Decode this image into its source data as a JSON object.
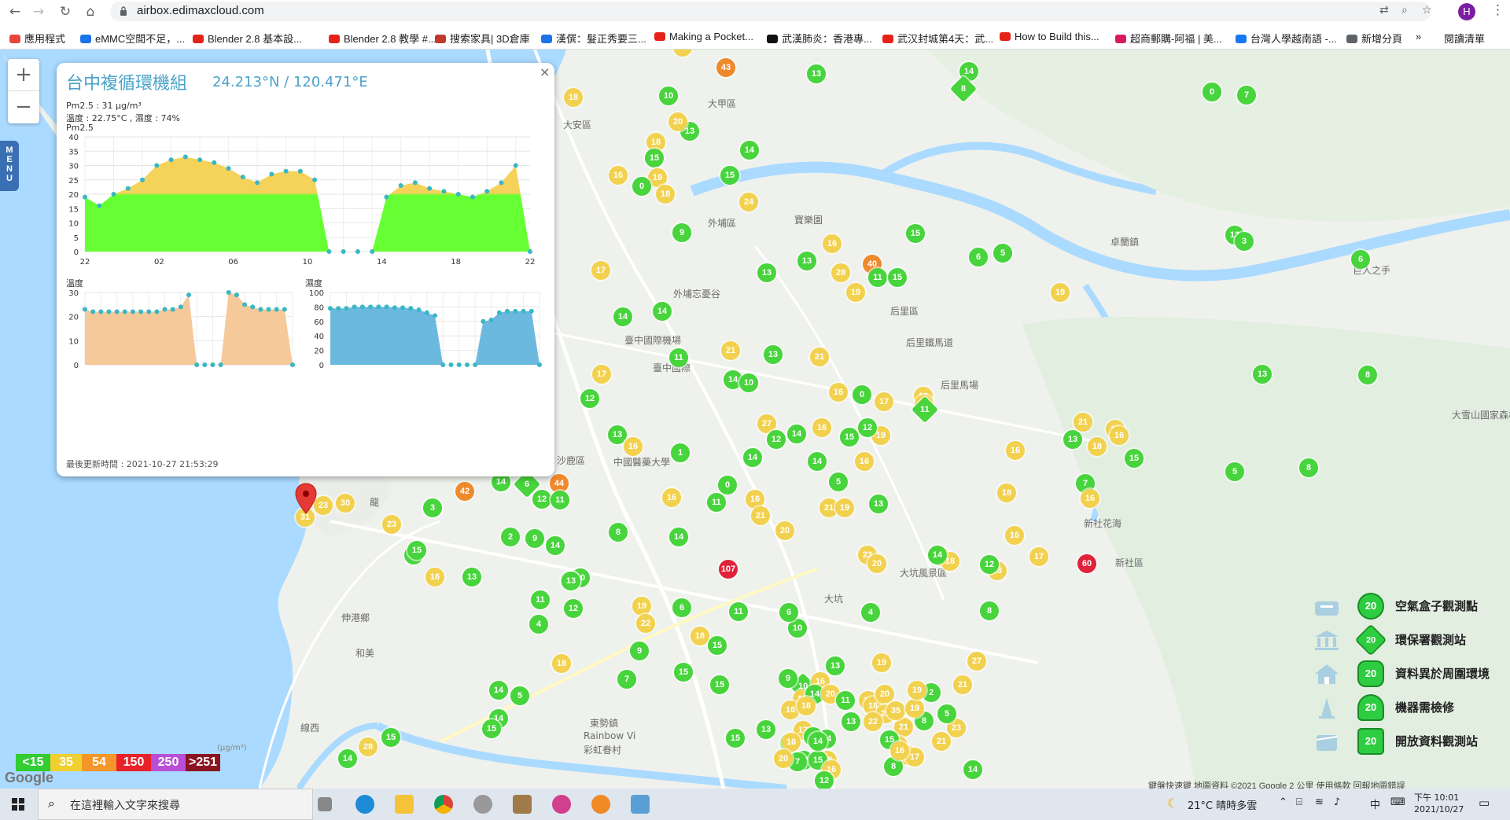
{
  "browser": {
    "url": "airbox.edimaxcloud.com",
    "profile_initial": "H",
    "bookmarks": [
      {
        "label": "應用程式",
        "color": "#e8453c"
      },
      {
        "label": "eMMC空間不足，...",
        "color": "#1a73e8"
      },
      {
        "label": "Blender 2.8 基本設...",
        "color": "#e62117"
      },
      {
        "label": "Blender 2.8 教學 #...",
        "color": "#e62117"
      },
      {
        "label": "搜索家具| 3D倉庫",
        "color": "#c0392b"
      },
      {
        "label": "漢僎：髮正秀要三...",
        "color": "#1a73e8"
      },
      {
        "label": "Making a Pocket...",
        "color": "#e62117"
      },
      {
        "label": "武漢肺炎：香港專...",
        "color": "#111111"
      },
      {
        "label": "武汉封城第4天：武...",
        "color": "#e62117"
      },
      {
        "label": "How to Build this...",
        "color": "#e62117"
      },
      {
        "label": "超商郵購-阿福 | 美...",
        "color": "#d81b60"
      },
      {
        "label": "台灣人學越南語 -...",
        "color": "#1877f2"
      },
      {
        "label": "新增分頁",
        "color": "#5f6368"
      }
    ],
    "reading_list": "閱讀清單"
  },
  "map": {
    "zoom_in": "+",
    "zoom_out": "−",
    "menu_label": "MENU",
    "place_labels": [
      "大甲區",
      "大安區",
      "外埔區",
      "后里區",
      "后里馬場",
      "外埔忘憂谷",
      "臺中國際機場",
      "沙鹿區",
      "龍",
      "伸港鄉",
      "和美",
      "線西",
      "東勢鎮",
      "卓蘭鎮",
      "新社區",
      "新社花海",
      "大坑風景區",
      "巨人之手",
      "大雪山國家森林遊樂區",
      "中國醫藥大學",
      "Rainbow Vi",
      "彩虹眷村",
      "后里鐵馬道",
      "臺中國際",
      "寶樂園",
      "大坑"
    ],
    "markers": [
      {
        "v": "19",
        "c": "y"
      },
      {
        "v": "43",
        "c": "o"
      },
      {
        "v": "13",
        "c": "g"
      },
      {
        "v": "14",
        "c": "g"
      },
      {
        "v": "8",
        "c": "gd"
      },
      {
        "v": "0",
        "c": "g"
      },
      {
        "v": "7",
        "c": "g"
      },
      {
        "v": "18",
        "c": "y"
      },
      {
        "v": "10",
        "c": "g"
      },
      {
        "v": "13",
        "c": "g"
      },
      {
        "v": "20",
        "c": "y"
      },
      {
        "v": "18",
        "c": "y"
      },
      {
        "v": "15",
        "c": "g"
      },
      {
        "v": "16",
        "c": "y"
      },
      {
        "v": "19",
        "c": "y"
      },
      {
        "v": "0",
        "c": "g"
      },
      {
        "v": "18",
        "c": "y"
      },
      {
        "v": "14",
        "c": "g"
      },
      {
        "v": "15",
        "c": "g"
      },
      {
        "v": "24",
        "c": "y"
      },
      {
        "v": "9",
        "c": "g"
      },
      {
        "v": "15",
        "c": "g"
      },
      {
        "v": "16",
        "c": "y"
      },
      {
        "v": "13",
        "c": "g"
      },
      {
        "v": "40",
        "c": "o"
      },
      {
        "v": "28",
        "c": "y"
      },
      {
        "v": "11",
        "c": "g"
      },
      {
        "v": "15",
        "c": "g"
      },
      {
        "v": "13",
        "c": "g"
      },
      {
        "v": "17",
        "c": "y"
      },
      {
        "v": "19",
        "c": "y"
      },
      {
        "v": "14",
        "c": "g"
      },
      {
        "v": "14",
        "c": "g"
      },
      {
        "v": "11",
        "c": "g"
      },
      {
        "v": "21",
        "c": "y"
      },
      {
        "v": "13",
        "c": "g"
      },
      {
        "v": "21",
        "c": "y"
      },
      {
        "v": "14",
        "c": "g"
      },
      {
        "v": "10",
        "c": "g"
      },
      {
        "v": "17",
        "c": "y"
      },
      {
        "v": "12",
        "c": "g"
      },
      {
        "v": "16",
        "c": "y"
      },
      {
        "v": "0",
        "c": "g"
      },
      {
        "v": "17",
        "c": "y"
      },
      {
        "v": "16",
        "c": "y"
      },
      {
        "v": "18",
        "c": "y"
      },
      {
        "v": "11",
        "c": "gd"
      },
      {
        "v": "27",
        "c": "y"
      },
      {
        "v": "16",
        "c": "y"
      },
      {
        "v": "12",
        "c": "g"
      },
      {
        "v": "14",
        "c": "g"
      },
      {
        "v": "15",
        "c": "g"
      },
      {
        "v": "19",
        "c": "y"
      },
      {
        "v": "12",
        "c": "g"
      },
      {
        "v": "16",
        "c": "y"
      },
      {
        "v": "13",
        "c": "g"
      },
      {
        "v": "16",
        "c": "y"
      },
      {
        "v": "1",
        "c": "g"
      },
      {
        "v": "14",
        "c": "g"
      },
      {
        "v": "14",
        "c": "g"
      },
      {
        "v": "5",
        "c": "g"
      },
      {
        "v": "44",
        "c": "o"
      },
      {
        "v": "42",
        "c": "o"
      },
      {
        "v": "14",
        "c": "g"
      },
      {
        "v": "6",
        "c": "gd"
      },
      {
        "v": "12",
        "c": "g"
      },
      {
        "v": "11",
        "c": "g"
      },
      {
        "v": "3",
        "c": "g"
      },
      {
        "v": "0",
        "c": "g"
      },
      {
        "v": "16",
        "c": "y"
      },
      {
        "v": "11",
        "c": "g"
      },
      {
        "v": "16",
        "c": "y"
      },
      {
        "v": "21",
        "c": "y"
      },
      {
        "v": "20",
        "c": "y"
      },
      {
        "v": "21",
        "c": "y"
      },
      {
        "v": "19",
        "c": "y"
      },
      {
        "v": "23",
        "c": "y"
      },
      {
        "v": "13",
        "c": "g"
      },
      {
        "v": "17",
        "c": "y"
      },
      {
        "v": "107",
        "c": "r"
      },
      {
        "v": "60",
        "c": "r"
      },
      {
        "v": "23",
        "c": "y"
      },
      {
        "v": "30",
        "c": "y"
      },
      {
        "v": "31",
        "c": "y"
      },
      {
        "v": "3",
        "c": "g"
      },
      {
        "v": "23",
        "c": "y"
      },
      {
        "v": "15",
        "c": "g"
      },
      {
        "v": "2",
        "c": "g"
      },
      {
        "v": "9",
        "c": "g"
      },
      {
        "v": "8",
        "c": "g"
      },
      {
        "v": "14",
        "c": "g"
      },
      {
        "v": "15",
        "c": "g"
      },
      {
        "v": "16",
        "c": "y"
      },
      {
        "v": "13",
        "c": "g"
      },
      {
        "v": "14",
        "c": "g"
      },
      {
        "v": "10",
        "c": "g"
      },
      {
        "v": "13",
        "c": "g"
      },
      {
        "v": "11",
        "c": "g"
      },
      {
        "v": "13",
        "c": "g"
      },
      {
        "v": "12",
        "c": "g"
      },
      {
        "v": "4",
        "c": "g"
      },
      {
        "v": "6",
        "c": "g"
      },
      {
        "v": "19",
        "c": "y"
      },
      {
        "v": "22",
        "c": "y"
      },
      {
        "v": "9",
        "c": "g"
      },
      {
        "v": "18",
        "c": "y"
      },
      {
        "v": "15",
        "c": "g"
      },
      {
        "v": "11",
        "c": "g"
      },
      {
        "v": "10",
        "c": "g"
      },
      {
        "v": "15",
        "c": "g"
      },
      {
        "v": "18",
        "c": "y"
      },
      {
        "v": "7",
        "c": "g"
      },
      {
        "v": "14",
        "c": "g"
      },
      {
        "v": "5",
        "c": "g"
      },
      {
        "v": "10",
        "c": "gd"
      },
      {
        "v": "15",
        "c": "g"
      },
      {
        "v": "28",
        "c": "y"
      },
      {
        "v": "14",
        "c": "g"
      },
      {
        "v": "15",
        "c": "g"
      },
      {
        "v": "14",
        "c": "g"
      },
      {
        "v": "15",
        "c": "g"
      },
      {
        "v": "6",
        "c": "g"
      },
      {
        "v": "13",
        "c": "g"
      },
      {
        "v": "19",
        "c": "y"
      },
      {
        "v": "16",
        "c": "y"
      },
      {
        "v": "9",
        "c": "g"
      },
      {
        "v": "16",
        "c": "y"
      },
      {
        "v": "15",
        "c": "g"
      },
      {
        "v": "18",
        "c": "y"
      },
      {
        "v": "13",
        "c": "g"
      },
      {
        "v": "16",
        "c": "y"
      },
      {
        "v": "14",
        "c": "g"
      },
      {
        "v": "20",
        "c": "y"
      },
      {
        "v": "11",
        "c": "g"
      },
      {
        "v": "13",
        "c": "g"
      },
      {
        "v": "18",
        "c": "y"
      },
      {
        "v": "20",
        "c": "y"
      },
      {
        "v": "21",
        "c": "y"
      },
      {
        "v": "21",
        "c": "y"
      },
      {
        "v": "17",
        "c": "y"
      },
      {
        "v": "8",
        "c": "g"
      },
      {
        "v": "6",
        "c": "g"
      },
      {
        "v": "5",
        "c": "g"
      },
      {
        "v": "13",
        "c": "g"
      },
      {
        "v": "3",
        "c": "g"
      },
      {
        "v": "6",
        "c": "g"
      },
      {
        "v": "13",
        "c": "g"
      },
      {
        "v": "8",
        "c": "g"
      },
      {
        "v": "8",
        "c": "g"
      },
      {
        "v": "5",
        "c": "g"
      },
      {
        "v": "19",
        "c": "y"
      },
      {
        "v": "16",
        "c": "y"
      },
      {
        "v": "18",
        "c": "y"
      },
      {
        "v": "16",
        "c": "y"
      },
      {
        "v": "17",
        "c": "y"
      },
      {
        "v": "23",
        "c": "y"
      },
      {
        "v": "18",
        "c": "y"
      },
      {
        "v": "14",
        "c": "g"
      },
      {
        "v": "12",
        "c": "g"
      },
      {
        "v": "20",
        "c": "y"
      },
      {
        "v": "8",
        "c": "g"
      },
      {
        "v": "17",
        "c": "y"
      },
      {
        "v": "16",
        "c": "y"
      },
      {
        "v": "13",
        "c": "g"
      },
      {
        "v": "21",
        "c": "y"
      },
      {
        "v": "18",
        "c": "y"
      },
      {
        "v": "15",
        "c": "g"
      },
      {
        "v": "7",
        "c": "g"
      },
      {
        "v": "16",
        "c": "y"
      },
      {
        "v": "4",
        "c": "g"
      },
      {
        "v": "35",
        "c": "y"
      },
      {
        "v": "2",
        "c": "g"
      },
      {
        "v": "23",
        "c": "y"
      },
      {
        "v": "19",
        "c": "y"
      },
      {
        "v": "21",
        "c": "y"
      },
      {
        "v": "19",
        "c": "y"
      },
      {
        "v": "23",
        "c": "y"
      },
      {
        "v": "5",
        "c": "g"
      },
      {
        "v": "27",
        "c": "y"
      },
      {
        "v": "21",
        "c": "y"
      },
      {
        "v": "27",
        "c": "y"
      },
      {
        "v": "14",
        "c": "g"
      },
      {
        "v": "8",
        "c": "g"
      },
      {
        "v": "17",
        "c": "y"
      },
      {
        "v": "22",
        "c": "y"
      },
      {
        "v": "15",
        "c": "g"
      },
      {
        "v": "17",
        "c": "y"
      },
      {
        "v": "14",
        "c": "g"
      },
      {
        "v": "16",
        "c": "y"
      },
      {
        "v": "18",
        "c": "y"
      },
      {
        "v": "16",
        "c": "y"
      },
      {
        "v": "12",
        "c": "g"
      },
      {
        "v": "14",
        "c": "g"
      },
      {
        "v": "15",
        "c": "g"
      },
      {
        "v": "7",
        "c": "g"
      },
      {
        "v": "8",
        "c": "g"
      },
      {
        "v": "14",
        "c": "g"
      },
      {
        "v": "16",
        "c": "y"
      },
      {
        "v": "20",
        "c": "y"
      },
      {
        "v": "16",
        "c": "y"
      },
      {
        "v": "12",
        "c": "g"
      }
    ]
  },
  "popup": {
    "title": "台中複循環機組",
    "coords": "24.213°N / 120.471°E",
    "pm25_line": "Pm2.5 : 31 μg/m³",
    "temp_line": "溫度 : 22.75°C , 濕度 : 74%",
    "pm25_title": "Pm2.5",
    "temp_title": "溫度",
    "hum_title": "濕度",
    "updated": "最後更新時間 : 2021-10-27 21:53:29",
    "close": "×"
  },
  "chart_data": [
    {
      "type": "area",
      "title": "Pm2.5",
      "x_tick_labels": [
        "22",
        "02",
        "06",
        "10",
        "14",
        "18",
        "22"
      ],
      "y_ticks": [
        0,
        5,
        10,
        15,
        20,
        25,
        30,
        35,
        40
      ],
      "ylim": [
        0,
        40
      ],
      "threshold": 20,
      "colors": {
        "below": "#66ff33",
        "above": "#f5d25a",
        "point": "#39b7c4"
      },
      "values": [
        19,
        16,
        20,
        22,
        25,
        30,
        32,
        33,
        32,
        31,
        29,
        26,
        24,
        27,
        28,
        28,
        25,
        0,
        0,
        0,
        0,
        19,
        23,
        24,
        22,
        21,
        20,
        19,
        21,
        24,
        30,
        0
      ]
    },
    {
      "type": "area",
      "title": "溫度",
      "y_ticks": [
        0,
        10,
        20,
        30
      ],
      "ylim": [
        0,
        30
      ],
      "colors": {
        "fill": "#f5c99a",
        "point": "#39b7c4"
      },
      "values": [
        23,
        22,
        22,
        22,
        22,
        22,
        22,
        22,
        22,
        22,
        23,
        23,
        24,
        29,
        0,
        0,
        0,
        0,
        30,
        29,
        25,
        24,
        23,
        23,
        23,
        23,
        0
      ]
    },
    {
      "type": "area",
      "title": "濕度",
      "y_ticks": [
        0,
        20,
        40,
        60,
        80,
        100
      ],
      "ylim": [
        0,
        100
      ],
      "colors": {
        "fill": "#6cb9e0",
        "point": "#39b7c4"
      },
      "values": [
        78,
        78,
        78,
        80,
        80,
        80,
        80,
        80,
        79,
        79,
        78,
        76,
        72,
        68,
        0,
        0,
        0,
        0,
        0,
        60,
        62,
        72,
        74,
        74,
        74,
        74,
        0
      ]
    }
  ],
  "legend_scale": [
    {
      "label": "<15",
      "color": "#33cc33"
    },
    {
      "label": "35",
      "color": "#f0d030"
    },
    {
      "label": "54",
      "color": "#f5962a"
    },
    {
      "label": "150",
      "color": "#e8222a"
    },
    {
      "label": "250",
      "color": "#b84fd6"
    },
    {
      "label": ">251",
      "color": "#8a1420"
    }
  ],
  "unit_label": "(μg/m³)",
  "google_label": "Google",
  "legend_types": [
    {
      "label": "空氣盒子觀測點",
      "sample": "20"
    },
    {
      "label": "環保署觀測站",
      "sample": "20"
    },
    {
      "label": "資料異於周圍環境",
      "sample": "20"
    },
    {
      "label": "機器需檢修",
      "sample": "20"
    },
    {
      "label": "開放資料觀測站",
      "sample": "20"
    }
  ],
  "attribution": "鍵盤快速鍵  地圖資料 ©2021 Google  2 公里  使用條款  回報地圖錯誤",
  "marker_colors": {
    "g": "#47d43c",
    "gd": "#47d43c",
    "y": "#f2d14f",
    "o": "#ee8a2c",
    "r": "#e0223a"
  },
  "taskbar": {
    "search_placeholder": "在這裡輸入文字來搜尋",
    "weather": "21°C  晴時多雲",
    "ime": "中",
    "time": "下午 10:01",
    "date": "2021/10/27"
  }
}
